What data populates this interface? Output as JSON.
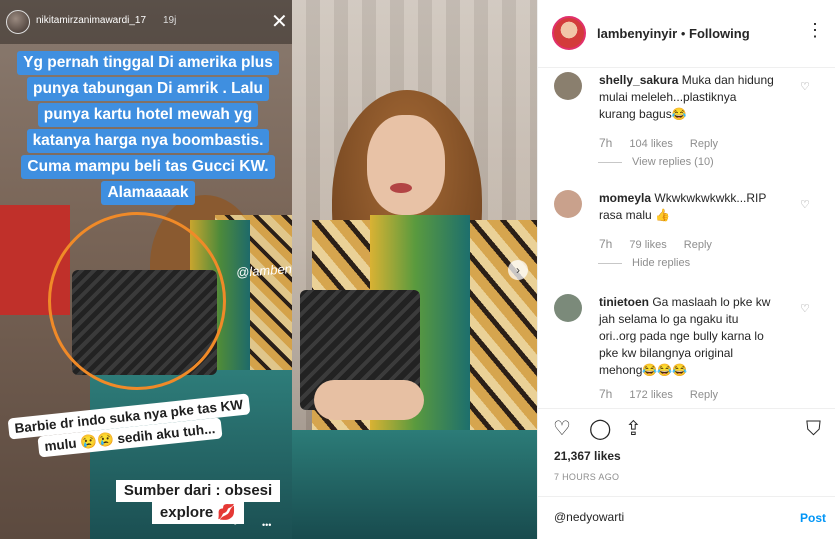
{
  "story": {
    "username": "nikitamirzanimawardi_17",
    "time": "19j",
    "caption_lines": [
      "Yg pernah tinggal Di amerika plus",
      "punya tabungan Di amrik . Lalu",
      "punya kartu hotel mewah yg",
      "katanya harga nya boombastis.",
      "Cuma mampu beli tas Gucci KW.",
      "Alamaaaak"
    ],
    "watermark": "@lambenyinyir",
    "sticker_lines": [
      "Barbie dr indo suka nya pke tas KW",
      "mulu 😢😢 sedih aku tuh..."
    ],
    "source_lines": [
      "Sumber dari : obsesi",
      "explore 💋"
    ]
  },
  "post": {
    "author": "lambenyinyir",
    "separator": "•",
    "follow_status": "Following",
    "likes": "21,367 likes",
    "time_ago": "7 HOURS AGO",
    "comment_input_value": "@nedyowarti",
    "post_label": "Post"
  },
  "comments": [
    {
      "username": "shelly_sakura",
      "text": "Muka dan hidung mulai meleleh...plastiknya kurang bagus😂",
      "time": "7h",
      "likes": "104 likes",
      "reply": "Reply",
      "replies_toggle": "View replies (10)",
      "avatar_color": "#8a7f6e"
    },
    {
      "username": "momeyla",
      "text": "Wkwkwkwkwkk...RIP rasa malu 👍",
      "time": "7h",
      "likes": "79 likes",
      "reply": "Reply",
      "replies_toggle": "Hide replies",
      "avatar_color": "#c9a18c"
    },
    {
      "username": "tinietoen",
      "text": "Ga maslaah lo pke kw jah selama lo ga ngaku itu ori..org pada nge bully karna lo pke kw bilangnya original mehong😂😂😂",
      "time": "7h",
      "likes": "172 likes",
      "reply": "Reply",
      "replies_toggle": "",
      "avatar_color": "#7b8a7a"
    }
  ],
  "icons": {
    "more": "more-icon",
    "like": "heart-icon",
    "comment": "comment-icon",
    "share": "share-icon",
    "save": "bookmark-icon",
    "close": "close-icon",
    "next": "chevron-right-icon"
  },
  "colors": {
    "caption_bg": "#3f8fe0",
    "circle": "#f08a28",
    "link": "#0095f6",
    "muted": "#8e8e8e"
  }
}
